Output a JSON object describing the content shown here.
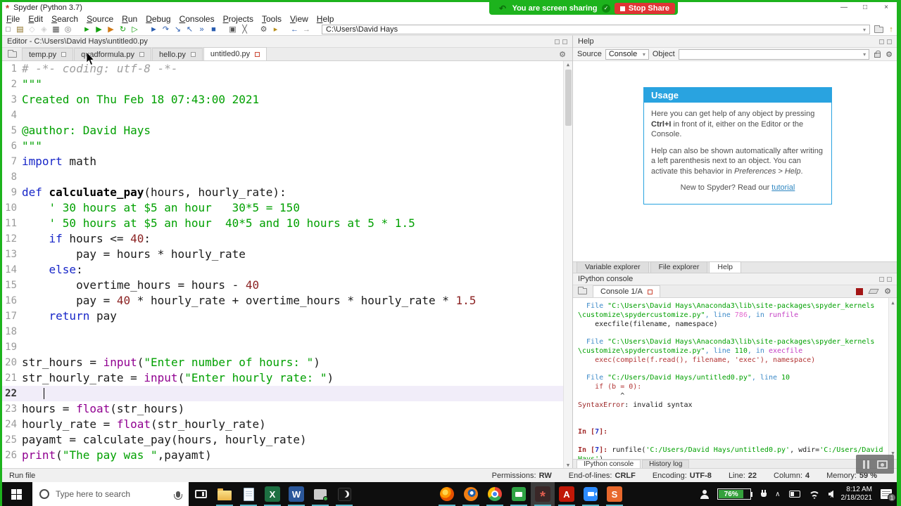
{
  "window": {
    "title": "Spyder (Python 3.7)",
    "controls": [
      {
        "n": "minimize-button",
        "g": "—"
      },
      {
        "n": "maximize-button",
        "g": "□"
      },
      {
        "n": "close-button",
        "g": "×"
      }
    ]
  },
  "share": {
    "text": "You are screen sharing",
    "stop_label": "Stop Share"
  },
  "menu": [
    "File",
    "Edit",
    "Search",
    "Source",
    "Run",
    "Debug",
    "Consoles",
    "Projects",
    "Tools",
    "View",
    "Help"
  ],
  "toolbar": {
    "path": "C:\\Users\\David Hays",
    "groups": [
      [
        {
          "n": "new-file",
          "g": "□",
          "c": "#555"
        },
        {
          "n": "open-file",
          "g": "▤",
          "c": "#8a6d1f"
        },
        {
          "n": "save-file",
          "g": "◇",
          "c": "#777",
          "dis": 1
        },
        {
          "n": "save-all",
          "g": "◈",
          "c": "#777",
          "dis": 1
        },
        {
          "n": "file-switcher",
          "g": "▦",
          "c": "#555"
        },
        {
          "n": "symbol-finder",
          "g": "◎",
          "c": "#777"
        }
      ],
      [
        {
          "n": "run-file",
          "g": "►",
          "c": "#13a10e"
        },
        {
          "n": "run-cell",
          "g": "▶",
          "c": "#13a10e"
        },
        {
          "n": "run-cell-advance",
          "g": "▶",
          "c": "#d07a16"
        },
        {
          "n": "re-run-cell",
          "g": "↻",
          "c": "#13a10e"
        },
        {
          "n": "run-selection",
          "g": "▷",
          "c": "#13a10e"
        }
      ],
      [
        {
          "n": "debug-file",
          "g": "►",
          "c": "#2a5db0"
        },
        {
          "n": "step",
          "g": "↷",
          "c": "#2a5db0"
        },
        {
          "n": "step-into",
          "g": "↘",
          "c": "#2a5db0"
        },
        {
          "n": "step-return",
          "g": "↖",
          "c": "#2a5db0"
        },
        {
          "n": "continue-execution",
          "g": "»",
          "c": "#2a5db0"
        },
        {
          "n": "stop-debugging",
          "g": "■",
          "c": "#2a5db0"
        }
      ],
      [
        {
          "n": "maximize-pane",
          "g": "▣",
          "c": "#555"
        },
        {
          "n": "fullscreen",
          "g": "╳",
          "c": "#555"
        }
      ],
      [
        {
          "n": "preferences",
          "g": "⚙",
          "c": "#555"
        },
        {
          "n": "python-path-manager",
          "g": "▸",
          "c": "#b8901d"
        }
      ],
      [
        {
          "n": "back",
          "g": "←",
          "c": "#2a5db0"
        },
        {
          "n": "forward",
          "g": "→",
          "c": "#9a9a9a"
        }
      ]
    ]
  },
  "editor": {
    "header": "Editor - C:\\Users\\David Hays\\untitled0.py",
    "tabs": [
      {
        "label": "temp.py",
        "active": false
      },
      {
        "label": "quadformula.py",
        "active": false
      },
      {
        "label": "hello.py",
        "active": false
      },
      {
        "label": "untitled0.py",
        "active": true
      }
    ],
    "current_line": 22,
    "lines": [
      [
        {
          "t": "# -*- coding: utf-8 -*-",
          "c": "c"
        }
      ],
      [
        {
          "t": "\"\"\"",
          "c": "s"
        }
      ],
      [
        {
          "t": "Created on Thu Feb 18 07:43:00 2021",
          "c": "s"
        }
      ],
      [],
      [
        {
          "t": "@author: David Hays",
          "c": "s"
        }
      ],
      [
        {
          "t": "\"\"\"",
          "c": "s"
        }
      ],
      [
        {
          "t": "import",
          "c": "k"
        },
        {
          "t": " math",
          "c": "p"
        }
      ],
      [],
      [
        {
          "t": "def",
          "c": "k"
        },
        {
          "t": " ",
          "c": "p"
        },
        {
          "t": "calculuate_pay",
          "c": "d"
        },
        {
          "t": "(hours, hourly_rate):",
          "c": "p"
        }
      ],
      [
        {
          "t": "    ",
          "c": "p"
        },
        {
          "t": "' 30 hours at $5 an hour   30*5 = 150",
          "c": "s"
        }
      ],
      [
        {
          "t": "    ",
          "c": "p"
        },
        {
          "t": "' 50 hours at $5 an hour  40*5 and 10 hours at 5 * 1.5",
          "c": "s"
        }
      ],
      [
        {
          "t": "    ",
          "c": "p"
        },
        {
          "t": "if",
          "c": "k"
        },
        {
          "t": " hours <= ",
          "c": "p"
        },
        {
          "t": "40",
          "c": "n"
        },
        {
          "t": ":",
          "c": "p"
        }
      ],
      [
        {
          "t": "        pay = hours * hourly_rate",
          "c": "p"
        }
      ],
      [
        {
          "t": "    ",
          "c": "p"
        },
        {
          "t": "else",
          "c": "k"
        },
        {
          "t": ":",
          "c": "p"
        }
      ],
      [
        {
          "t": "        overtime_hours = hours - ",
          "c": "p"
        },
        {
          "t": "40",
          "c": "n"
        }
      ],
      [
        {
          "t": "        pay = ",
          "c": "p"
        },
        {
          "t": "40",
          "c": "n"
        },
        {
          "t": " * hourly_rate + overtime_hours * hourly_rate * ",
          "c": "p"
        },
        {
          "t": "1.5",
          "c": "n"
        }
      ],
      [
        {
          "t": "    ",
          "c": "p"
        },
        {
          "t": "return",
          "c": "k"
        },
        {
          "t": " pay",
          "c": "p"
        }
      ],
      [],
      [],
      [
        {
          "t": "str_hours = ",
          "c": "p"
        },
        {
          "t": "input",
          "c": "b"
        },
        {
          "t": "(",
          "c": "p"
        },
        {
          "t": "\"Enter number of hours: \"",
          "c": "s"
        },
        {
          "t": ")",
          "c": "p"
        }
      ],
      [
        {
          "t": "str_hourly_rate = ",
          "c": "p"
        },
        {
          "t": "input",
          "c": "b"
        },
        {
          "t": "(",
          "c": "p"
        },
        {
          "t": "\"Enter hourly rate: \"",
          "c": "s"
        },
        {
          "t": ")",
          "c": "p"
        }
      ],
      [],
      [
        {
          "t": "hours = ",
          "c": "p"
        },
        {
          "t": "float",
          "c": "b"
        },
        {
          "t": "(str_hours)",
          "c": "p"
        }
      ],
      [
        {
          "t": "hourly_rate = ",
          "c": "p"
        },
        {
          "t": "float",
          "c": "b"
        },
        {
          "t": "(str_hourly_rate)",
          "c": "p"
        }
      ],
      [
        {
          "t": "payamt = calculate_pay(hours, hourly_rate)",
          "c": "p"
        }
      ],
      [
        {
          "t": "print",
          "c": "b"
        },
        {
          "t": "(",
          "c": "p"
        },
        {
          "t": "\"The pay was \"",
          "c": "s"
        },
        {
          "t": ",payamt)",
          "c": "p"
        }
      ]
    ]
  },
  "help": {
    "title": "Help",
    "source_label": "Source",
    "source_value": "Console",
    "object_label": "Object",
    "usage": {
      "title": "Usage",
      "paragraphs": [
        {
          "segs": [
            {
              "t": "Here you can get help of any object by pressing "
            },
            {
              "t": "Ctrl+I",
              "b": 1
            },
            {
              "t": " in front of it, either on the Editor or the Console."
            }
          ]
        },
        {
          "segs": [
            {
              "t": "Help can also be shown automatically after writing a left parenthesis next to an object. You can activate this behavior in "
            },
            {
              "t": "Preferences > Help",
              "i": 1
            },
            {
              "t": "."
            }
          ]
        },
        {
          "center": 1,
          "segs": [
            {
              "t": "New to Spyder? Read our "
            },
            {
              "t": "tutorial",
              "link": 1
            }
          ]
        }
      ]
    }
  },
  "right_tabs": {
    "items": [
      "Variable explorer",
      "File explorer",
      "Help"
    ],
    "active": 2
  },
  "console": {
    "title": "IPython console",
    "tab": "Console 1/A",
    "bottom_tabs": {
      "items": [
        "IPython console",
        "History log"
      ],
      "active": 0
    },
    "lines": [
      [
        {
          "t": "  File ",
          "c": "lbl"
        },
        {
          "t": "\"C:\\Users\\David Hays\\Anaconda3\\lib\\site-packages\\spyder_kernels",
          "c": "pth"
        }
      ],
      [
        {
          "t": "\\customize\\spydercustomize.py\"",
          "c": "pth"
        },
        {
          "t": ", line ",
          "c": "lbl"
        },
        {
          "t": "786",
          "c": "pk"
        },
        {
          "t": ", in ",
          "c": "lbl"
        },
        {
          "t": "runfile",
          "c": "fn"
        }
      ],
      [
        {
          "t": "    execfile(filename, namespace)",
          "c": "pl"
        }
      ],
      [],
      [
        {
          "t": "  File ",
          "c": "lbl"
        },
        {
          "t": "\"C:\\Users\\David Hays\\Anaconda3\\lib\\site-packages\\spyder_kernels",
          "c": "pth"
        }
      ],
      [
        {
          "t": "\\customize\\spydercustomize.py\"",
          "c": "pth"
        },
        {
          "t": ", line ",
          "c": "lbl"
        },
        {
          "t": "110",
          "c": "gn"
        },
        {
          "t": ", in ",
          "c": "lbl"
        },
        {
          "t": "execfile",
          "c": "fn"
        }
      ],
      [
        {
          "t": "    exec(compile(f.read(), filename, 'exec'), namespace)",
          "c": "err"
        }
      ],
      [],
      [
        {
          "t": "  File ",
          "c": "lbl"
        },
        {
          "t": "\"C:/Users/David Hays/untitled0.py\"",
          "c": "pth"
        },
        {
          "t": ", line ",
          "c": "lbl"
        },
        {
          "t": "10",
          "c": "gn"
        }
      ],
      [
        {
          "t": "    if (b = 0):",
          "c": "err"
        }
      ],
      [
        {
          "t": "          ^",
          "c": "pl"
        }
      ],
      [
        {
          "t": "SyntaxError",
          "c": "exc"
        },
        {
          "t": ": invalid syntax",
          "c": "pl"
        }
      ],
      [],
      [],
      [
        {
          "t": "In [",
          "c": "pr"
        },
        {
          "t": "7",
          "c": "prn"
        },
        {
          "t": "]:",
          "c": "pr"
        }
      ],
      [],
      [
        {
          "t": "In [",
          "c": "pr"
        },
        {
          "t": "7",
          "c": "prn"
        },
        {
          "t": "]: ",
          "c": "pr"
        },
        {
          "t": "runfile(",
          "c": "pl"
        },
        {
          "t": "'C:/Users/David Hays/untitled0.py'",
          "c": "pth"
        },
        {
          "t": ", wdir=",
          "c": "pl"
        },
        {
          "t": "'C:/Users/David",
          "c": "pth"
        }
      ],
      [
        {
          "t": "Hays'",
          "c": "pth"
        },
        {
          "t": ")",
          "c": "pl"
        }
      ]
    ]
  },
  "statusbar": {
    "hint": "Run file",
    "items": [
      {
        "l": "Permissions:",
        "v": "RW"
      },
      {
        "l": "End-of-lines:",
        "v": "CRLF"
      },
      {
        "l": "Encoding:",
        "v": "UTF-8"
      },
      {
        "l": "Line:",
        "v": "22"
      },
      {
        "l": "Column:",
        "v": "4"
      },
      {
        "l": "Memory:",
        "v": "59 %"
      }
    ]
  },
  "taskbar": {
    "search_placeholder": "Type here to search",
    "apps": [
      {
        "n": "task-view"
      },
      {
        "n": "file-explorer",
        "run": 1
      },
      {
        "n": "notepad",
        "run": 1
      },
      {
        "n": "excel",
        "g": "X",
        "bg": "#1d6f42",
        "run": 1
      },
      {
        "n": "word",
        "g": "W",
        "bg": "#2b579a",
        "run": 1
      },
      {
        "n": "server",
        "run": 1
      },
      {
        "n": "media-player",
        "run": 1
      },
      {
        "sp": 1
      },
      {
        "n": "firefox",
        "run": 1
      },
      {
        "n": "blender",
        "run": 1
      },
      {
        "n": "chrome",
        "run": 1
      },
      {
        "n": "flexti",
        "run": 1
      },
      {
        "n": "spyder",
        "g": "*",
        "bg": "#3a2727",
        "gc": "#e25e50",
        "run": 1,
        "active": 1
      },
      {
        "n": "acrobat",
        "g": "A",
        "bg": "#c11807",
        "run": 1
      },
      {
        "n": "zoom",
        "run": 1
      },
      {
        "n": "sublime",
        "g": "S",
        "bg": "#e8682c",
        "run": 1
      }
    ],
    "tray": {
      "battery": "76%",
      "time": "8:12 AM",
      "date": "2/18/2021",
      "badge": "1"
    }
  }
}
